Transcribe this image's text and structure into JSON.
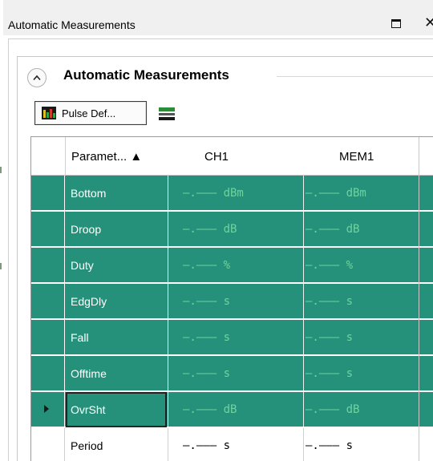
{
  "window": {
    "title": "Automatic Measurements",
    "restore_icon": "restore-window-icon",
    "close_icon": "close-icon",
    "close_glyph": "✕"
  },
  "group": {
    "title": "Automatic Measurements",
    "collapse_icon": "chevron-up-icon"
  },
  "toolbar": {
    "pulse_def_label": "Pulse Def...",
    "pulse_def_icon": "pulse-definition-icon",
    "bus_icon": "bus-icon"
  },
  "grid": {
    "columns": [
      "Paramet... ▲",
      "CH1",
      "MEM1"
    ],
    "rows": [
      {
        "param": "Bottom",
        "ch1": "–.––– dBm",
        "mem1": "–.––– dBm",
        "selected": true
      },
      {
        "param": "Droop",
        "ch1": "–.––– dB",
        "mem1": "–.––– dB",
        "selected": true
      },
      {
        "param": "Duty",
        "ch1": "–.––– %",
        "mem1": "–.––– %",
        "selected": true
      },
      {
        "param": "EdgDly",
        "ch1": "–.––– s",
        "mem1": "–.––– s",
        "selected": true
      },
      {
        "param": "Fall",
        "ch1": "–.––– s",
        "mem1": "–.––– s",
        "selected": true
      },
      {
        "param": "Offtime",
        "ch1": "–.––– s",
        "mem1": "–.––– s",
        "selected": true
      },
      {
        "param": "OvrSht",
        "ch1": "–.––– dB",
        "mem1": "–.––– dB",
        "selected": true,
        "current": true
      },
      {
        "param": "Period",
        "ch1": "–.––– s",
        "mem1": "–.––– s",
        "selected": false
      }
    ]
  },
  "colors": {
    "selection": "#26917a",
    "value_text_selected": "#6fd39e"
  }
}
